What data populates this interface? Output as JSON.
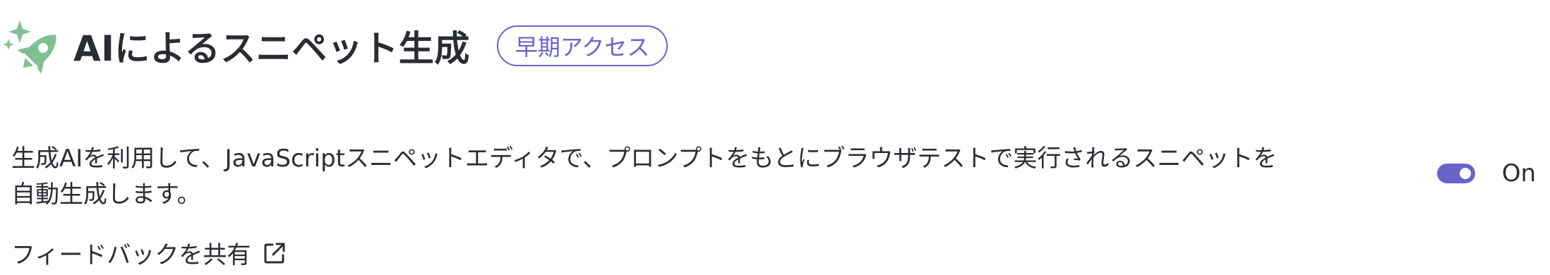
{
  "header": {
    "icon": "rocket-sparkle-icon",
    "title": "AIによるスニペット生成",
    "badge": "早期アクセス"
  },
  "setting": {
    "description_line1": "生成AIを利用して、JavaScriptスニペットエディタで、プロンプトをもとにブラウザテストで実行されるスニペットを",
    "description_line2": "自動生成します。",
    "toggle_state": "On"
  },
  "feedback": {
    "link_label": "フィードバックを共有",
    "icon": "external-link-icon"
  },
  "colors": {
    "accent": "#6b63c9",
    "icon_green": "#7fbf94",
    "text": "#2b2d33"
  }
}
